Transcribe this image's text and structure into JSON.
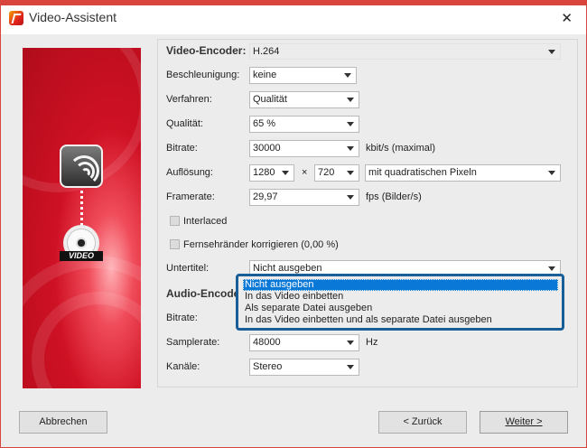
{
  "window": {
    "title": "Video-Assistent",
    "close": "✕"
  },
  "sidebar": {
    "video_badge": "VIDEO"
  },
  "form": {
    "video_encoder": {
      "label": "Video-Encoder:",
      "value": "H.264"
    },
    "beschleunigung": {
      "label": "Beschleunigung:",
      "value": "keine"
    },
    "verfahren": {
      "label": "Verfahren:",
      "value": "Qualität"
    },
    "qualitaet": {
      "label": "Qualität:",
      "value": "65 %"
    },
    "bitrate": {
      "label": "Bitrate:",
      "value": "30000",
      "unit": "kbit/s (maximal)"
    },
    "aufloesung": {
      "label": "Auflösung:",
      "width": "1280",
      "times": "×",
      "height": "720",
      "pixel_mode": "mit quadratischen Pixeln"
    },
    "framerate": {
      "label": "Framerate:",
      "value": "29,97",
      "unit": "fps (Bilder/s)"
    },
    "interlaced": {
      "label": "Interlaced",
      "checked": false
    },
    "fernsehraender": {
      "label": "Fernsehränder korrigieren (0,00 %)",
      "checked": false
    },
    "untertitel": {
      "label": "Untertitel:",
      "value": "Nicht ausgeben"
    },
    "audio_encoder": {
      "label": "Audio-Encoder:"
    },
    "audio_bitrate": {
      "label": "Bitrate:"
    },
    "samplerate": {
      "label": "Samplerate:",
      "value": "48000",
      "unit": "Hz"
    },
    "kanaele": {
      "label": "Kanäle:",
      "value": "Stereo"
    }
  },
  "untertitel_dropdown": {
    "options": [
      "Nicht ausgeben",
      "In das Video einbetten",
      "Als separate Datei ausgeben",
      "In das Video einbetten und als separate Datei ausgeben"
    ],
    "selected_index": 0
  },
  "buttons": {
    "cancel": "Abbrechen",
    "back": "< Zurück",
    "next": "Weiter >"
  }
}
